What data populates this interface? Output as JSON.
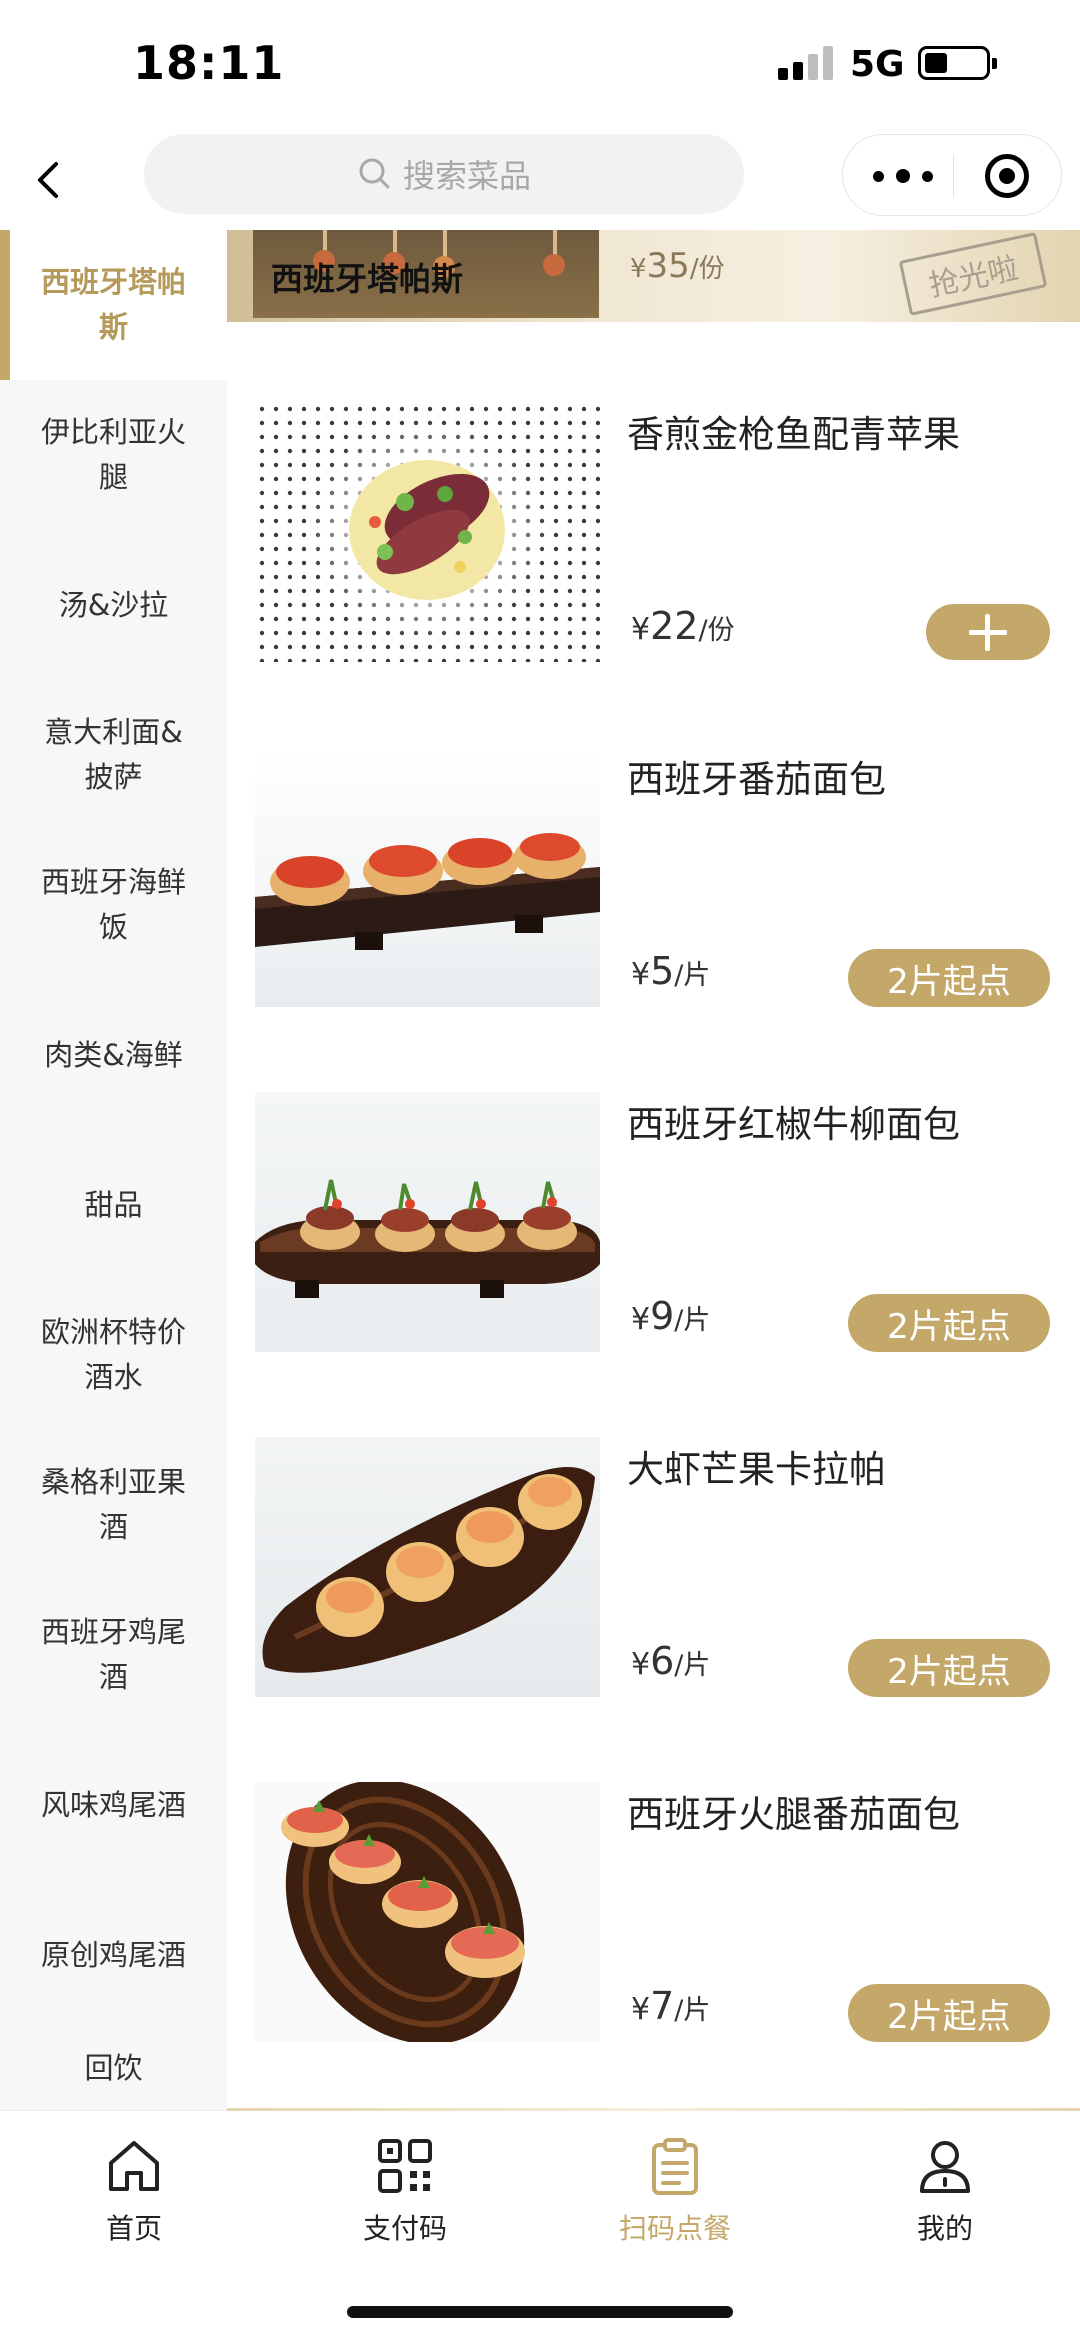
{
  "status_bar": {
    "time": "18:11",
    "network": "5G"
  },
  "header": {
    "search_placeholder": "搜索菜品"
  },
  "sidebar": {
    "categories": [
      "西班牙塔帕斯",
      "伊比利亚火腿",
      "汤&沙拉",
      "意大利面&披萨",
      "西班牙海鲜饭",
      "肉类&海鲜",
      "甜品",
      "欧洲杯特价酒水",
      "桑格利亚果酒",
      "西班牙鸡尾酒",
      "风味鸡尾酒",
      "原创鸡尾酒",
      "回饮"
    ]
  },
  "banner": {
    "title": "西班牙塔帕斯",
    "price_symbol": "¥",
    "price": "35",
    "unit": "/份",
    "stamp": "抢光啦"
  },
  "items": [
    {
      "name": "香煎金枪鱼配青苹果",
      "price_symbol": "¥",
      "price": "22",
      "unit": "/份",
      "action": "add"
    },
    {
      "name": "西班牙番茄面包",
      "price_symbol": "¥",
      "price": "5",
      "unit": "/片",
      "action": "2片起点"
    },
    {
      "name": "西班牙红椒牛柳面包",
      "price_symbol": "¥",
      "price": "9",
      "unit": "/片",
      "action": "2片起点"
    },
    {
      "name": "大虾芒果卡拉帕",
      "price_symbol": "¥",
      "price": "6",
      "unit": "/片",
      "action": "2片起点"
    },
    {
      "name": "西班牙火腿番茄面包",
      "price_symbol": "¥",
      "price": "7",
      "unit": "/片",
      "action": "2片起点"
    }
  ],
  "tabbar": {
    "tabs": [
      {
        "label": "首页",
        "icon": "home-icon"
      },
      {
        "label": "支付码",
        "icon": "qr-code-icon"
      },
      {
        "label": "扫码点餐",
        "icon": "clipboard-icon"
      },
      {
        "label": "我的",
        "icon": "user-icon"
      }
    ],
    "active_index": 2
  },
  "colors": {
    "accent": "#c4a86a",
    "accent_text": "#b59a5c",
    "sidebar_bg": "#f7f7f7"
  }
}
